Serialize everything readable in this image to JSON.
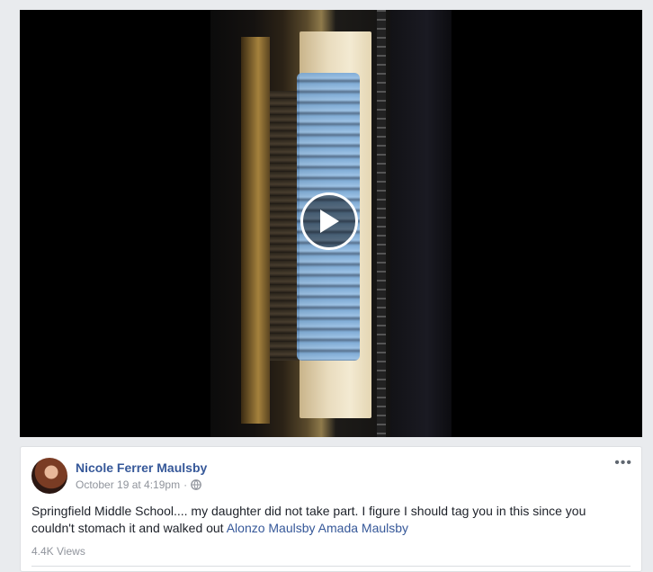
{
  "video": {
    "play_icon": "play-icon"
  },
  "post": {
    "author": "Nicole Ferrer Maulsby",
    "timestamp": "October 19 at 4:19pm",
    "separator": "·",
    "privacy_icon": "globe-icon",
    "more_icon": "more-options-icon",
    "more_label": "•••",
    "text_main": "Springfield Middle School.... my daughter did not take part. I figure I should tag you in this since you couldn't stomach it and walked out",
    "tags": [
      "Alonzo Maulsby",
      "Amada Maulsby"
    ],
    "views": "4.4K Views"
  },
  "colors": {
    "link": "#365899",
    "meta": "#90949c",
    "background": "#e9ebee"
  }
}
